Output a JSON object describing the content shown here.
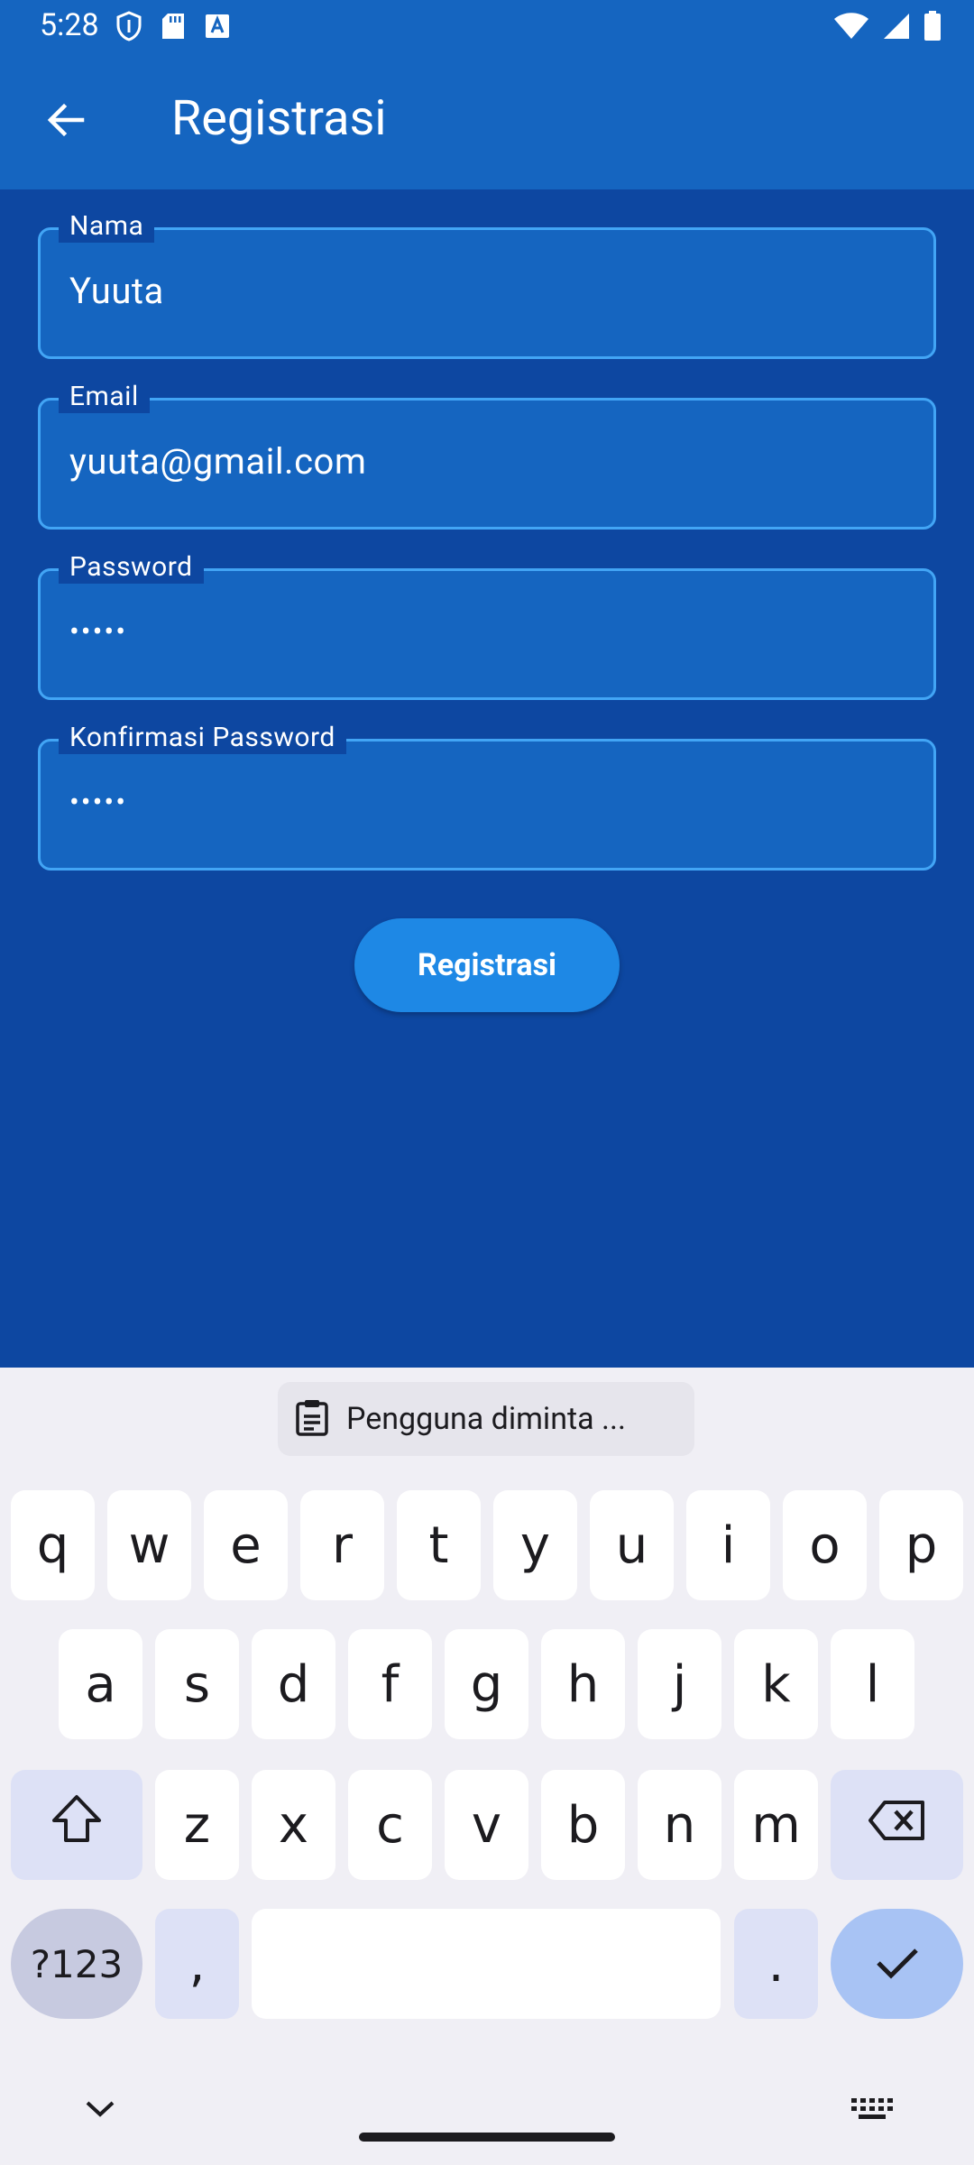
{
  "status": {
    "time": "5:28"
  },
  "appbar": {
    "title": "Registrasi"
  },
  "form": {
    "fields": [
      {
        "label": "Nama",
        "value": "Yuuta"
      },
      {
        "label": "Email",
        "value": "yuuta@gmail.com"
      },
      {
        "label": "Password",
        "value": "•••••"
      },
      {
        "label": "Konfirmasi Password",
        "value": "•••••"
      }
    ],
    "submit_label": "Registrasi"
  },
  "keyboard": {
    "suggestion": "Pengguna diminta ...",
    "row1": [
      "q",
      "w",
      "e",
      "r",
      "t",
      "y",
      "u",
      "i",
      "o",
      "p"
    ],
    "row2": [
      "a",
      "s",
      "d",
      "f",
      "g",
      "h",
      "j",
      "k",
      "l"
    ],
    "row3": [
      "z",
      "x",
      "c",
      "v",
      "b",
      "n",
      "m"
    ],
    "symbols_label": "?123",
    "comma_label": ",",
    "period_label": "."
  },
  "colors": {
    "appbar": "#1565C0",
    "background": "#0D47A1",
    "field_border": "#42A5F5",
    "button": "#1E88E5"
  }
}
